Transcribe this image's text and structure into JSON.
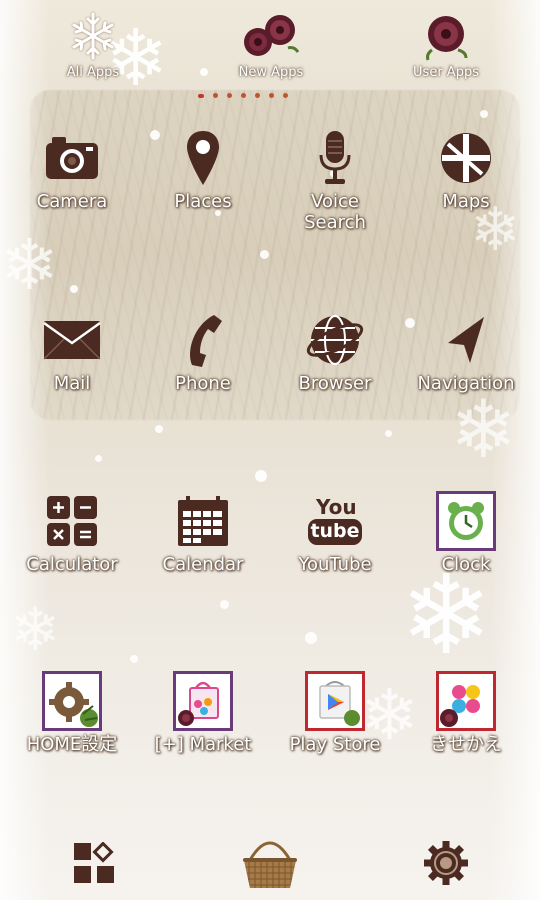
{
  "top_bar": {
    "all_apps": "All Apps",
    "new_apps": "New Apps",
    "user_apps": "User Apps"
  },
  "pager": {
    "pages": 7,
    "current": 1
  },
  "apps": {
    "camera": "Camera",
    "places": "Places",
    "voice_search": "Voice\nSearch",
    "maps": "Maps",
    "mail": "Mail",
    "phone": "Phone",
    "browser": "Browser",
    "navigation": "Navigation",
    "calculator": "Calculator",
    "calendar": "Calendar",
    "youtube": "YouTube",
    "youtube_icon_top": "You",
    "youtube_icon_bottom": "tube",
    "clock": "Clock",
    "home_settings": "HOME設定",
    "market": "[+] Market",
    "play_store": "Play Store",
    "kisekae": "きせかえ"
  },
  "dock": {
    "left": "apps-grid-icon",
    "center": "basket-icon",
    "right": "settings-gear-icon"
  },
  "colors": {
    "icon_brown": "#4b2a22",
    "label_shadow": "#5a4332",
    "frame_purple": "#6a3b7a",
    "frame_red": "#c0282f",
    "pager_dot": "#c2542b"
  }
}
